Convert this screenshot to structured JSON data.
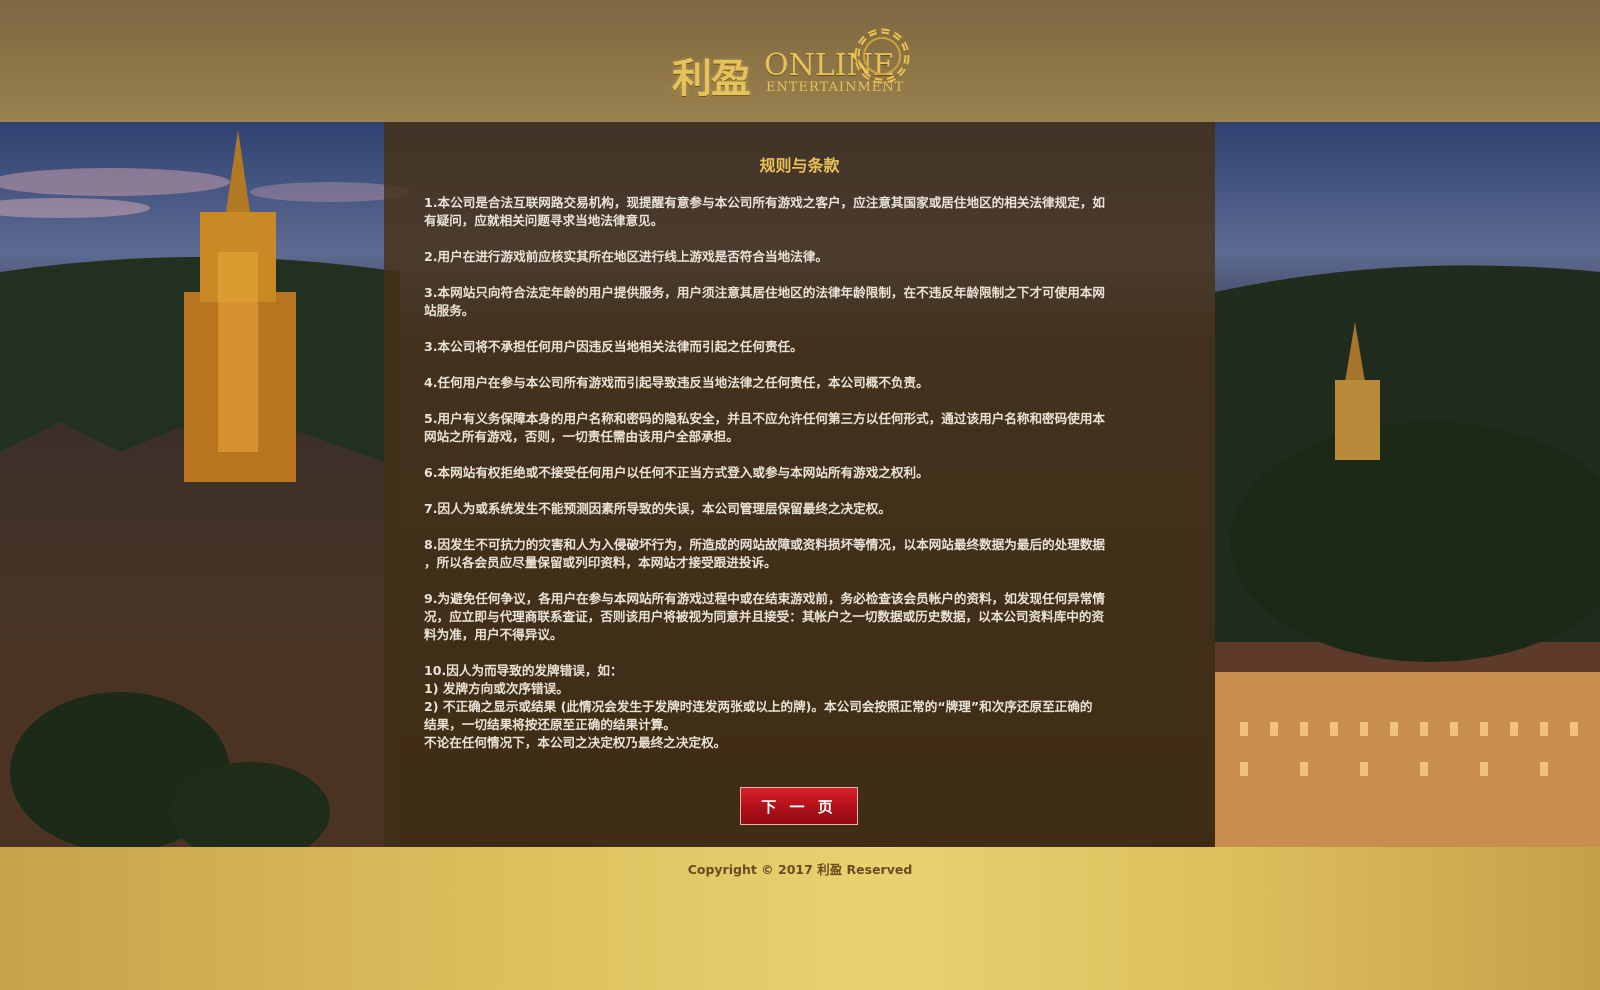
{
  "logo": {
    "brand_cn": "利盈",
    "brand_en": "ONLINE",
    "tagline": "ENTERTAINMENT",
    "icon": "casino-chip-icon"
  },
  "panel": {
    "title": "规则与条款",
    "terms": [
      {
        "lines": [
          "1.本公司是合法互联网路交易机构，现提醒有意参与本公司所有游戏之客户，应注意其国家或居住地区的相关法律规定，如",
          "有疑问，应就相关问题寻求当地法律意见。"
        ]
      },
      {
        "lines": [
          "2.用户在进行游戏前应核实其所在地区进行线上游戏是否符合当地法律。"
        ]
      },
      {
        "lines": [
          "3.本网站只向符合法定年龄的用户提供服务，用户须注意其居住地区的法律年龄限制，在不违反年龄限制之下才可使用本网",
          "站服务。"
        ]
      },
      {
        "lines": [
          "3.本公司将不承担任何用户因违反当地相关法律而引起之任何责任。"
        ]
      },
      {
        "lines": [
          "4.任何用户在参与本公司所有游戏而引起导致违反当地法律之任何责任，本公司概不负责。"
        ]
      },
      {
        "lines": [
          "5.用户有义务保障本身的用户名称和密码的隐私安全，并且不应允许任何第三方以任何形式，通过该用户名称和密码使用本",
          "网站之所有游戏，否则，一切责任需由该用户全部承担。"
        ]
      },
      {
        "lines": [
          "6.本网站有权拒绝或不接受任何用户以任何不正当方式登入或参与本网站所有游戏之权利。"
        ]
      },
      {
        "lines": [
          "7.因人为或系统发生不能预测因素所导致的失误，本公司管理层保留最终之决定权。"
        ]
      },
      {
        "lines": [
          "8.因发生不可抗力的灾害和人为入侵破坏行为，所造成的网站故障或资料损坏等情况，以本网站最终数据为最后的处理数据",
          "，所以各会员应尽量保留或列印资料，本网站才接受跟进投诉。"
        ]
      },
      {
        "lines": [
          "9.为避免任何争议，各用户在参与本网站所有游戏过程中或在结束游戏前，务必检查该会员帐户的资料，如发现任何异常情",
          "况，应立即与代理商联系查证，否则该用户将被视为同意并且接受：其帐户之一切数据或历史数据，以本公司资料库中的资",
          "料为准，用户不得异议。"
        ]
      },
      {
        "lines": [
          "10.因人为而导致的发牌错误，如：",
          "1) 发牌方向或次序错误。",
          "2) 不正确之显示或结果 (此情况会发生于发牌时连发两张或以上的牌)。本公司会按照正常的“牌理”和次序还原至正确的",
          "结果，一切结果将按还原至正确的结果计算。",
          "不论在任何情况下，本公司之决定权乃最终之决定权。"
        ]
      }
    ],
    "next_button": "下 一 页"
  },
  "footer": {
    "copyright": "Copyright © 2017 利盈 Reserved"
  },
  "colors": {
    "header": "#8a7147",
    "panel_title": "#e8c15a",
    "button": "#c0141e",
    "footer": "#e0c463"
  }
}
